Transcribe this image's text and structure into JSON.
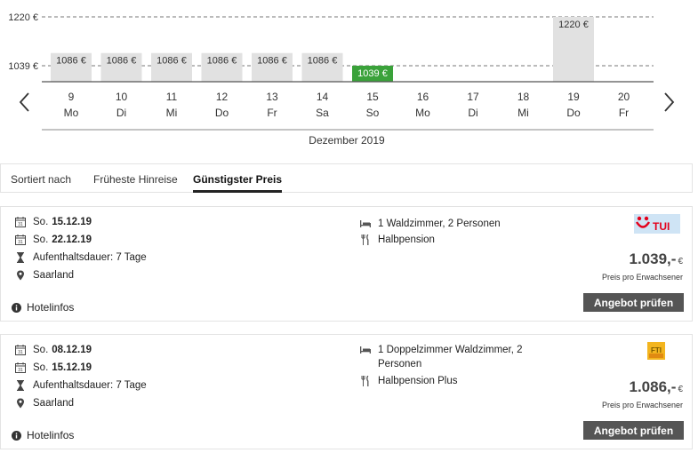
{
  "chart_data": {
    "type": "bar",
    "month_label": "Dezember 2019",
    "y_ticks": [
      "1220 €",
      "1039 €"
    ],
    "y_tick_values": [
      1220,
      1039
    ],
    "days": [
      {
        "num": "9",
        "weekday": "Mo",
        "value": 1086,
        "label": "1086 €",
        "selected": false
      },
      {
        "num": "10",
        "weekday": "Di",
        "value": 1086,
        "label": "1086 €",
        "selected": false
      },
      {
        "num": "11",
        "weekday": "Mi",
        "value": 1086,
        "label": "1086 €",
        "selected": false
      },
      {
        "num": "12",
        "weekday": "Do",
        "value": 1086,
        "label": "1086 €",
        "selected": false
      },
      {
        "num": "13",
        "weekday": "Fr",
        "value": 1086,
        "label": "1086 €",
        "selected": false
      },
      {
        "num": "14",
        "weekday": "Sa",
        "value": 1086,
        "label": "1086 €",
        "selected": false
      },
      {
        "num": "15",
        "weekday": "So",
        "value": 1039,
        "label": "1039 €",
        "selected": true
      },
      {
        "num": "16",
        "weekday": "Mo",
        "value": null,
        "label": "",
        "selected": false
      },
      {
        "num": "17",
        "weekday": "Di",
        "value": null,
        "label": "",
        "selected": false
      },
      {
        "num": "18",
        "weekday": "Mi",
        "value": null,
        "label": "",
        "selected": false
      },
      {
        "num": "19",
        "weekday": "Do",
        "value": 1220,
        "label": "1220 €",
        "selected": false
      },
      {
        "num": "20",
        "weekday": "Fr",
        "value": null,
        "label": "",
        "selected": false
      }
    ],
    "colors": {
      "bar": "#e1e1e1",
      "selected": "#3aa23a",
      "grid": "#777777"
    }
  },
  "sort": {
    "label": "Sortiert nach",
    "options": [
      "Früheste Hinreise",
      "Günstigster Preis"
    ],
    "active": "Günstigster Preis"
  },
  "icons": {
    "calendar": "calendar-icon",
    "hourglass": "hourglass-icon",
    "location": "location-pin-icon",
    "bed": "bed-icon",
    "meal": "cutlery-icon",
    "info": "info-icon"
  },
  "offers": [
    {
      "depart_day": "So.",
      "depart_date": "15.12.19",
      "return_day": "So.",
      "return_date": "22.12.19",
      "duration": "Aufenthaltsdauer: 7 Tage",
      "location": "Saarland",
      "room": "1 Waldzimmer, 2 Personen",
      "board": "Halbpension",
      "price": "1.039,-",
      "currency": "€",
      "price_note": "Preis pro Erwachsener",
      "button": "Angebot prüfen",
      "hotelinfo": "Hotelinfos",
      "operator_logo": "TUI"
    },
    {
      "depart_day": "So.",
      "depart_date": "08.12.19",
      "return_day": "So.",
      "return_date": "15.12.19",
      "duration": "Aufenthaltsdauer: 7 Tage",
      "location": "Saarland",
      "room": "1 Doppelzimmer Waldzimmer, 2 Personen",
      "board": "Halbpension Plus",
      "price": "1.086,-",
      "currency": "€",
      "price_note": "Preis pro Erwachsener",
      "button": "Angebot prüfen",
      "hotelinfo": "Hotelinfos",
      "operator_logo": "FTI"
    }
  ]
}
